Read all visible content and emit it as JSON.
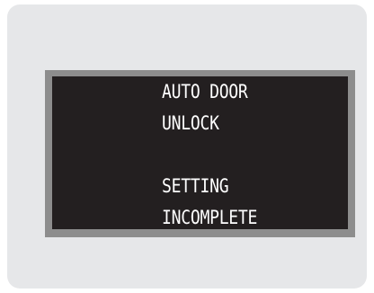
{
  "display": {
    "line1": "AUTO DOOR",
    "line2": "UNLOCK",
    "line3": "SETTING",
    "line4": "INCOMPLETE"
  },
  "colors": {
    "panel_background": "#e6e7e9",
    "display_bezel": "#8d8d8d",
    "display_background": "#231f20",
    "display_text": "#ffffff"
  }
}
